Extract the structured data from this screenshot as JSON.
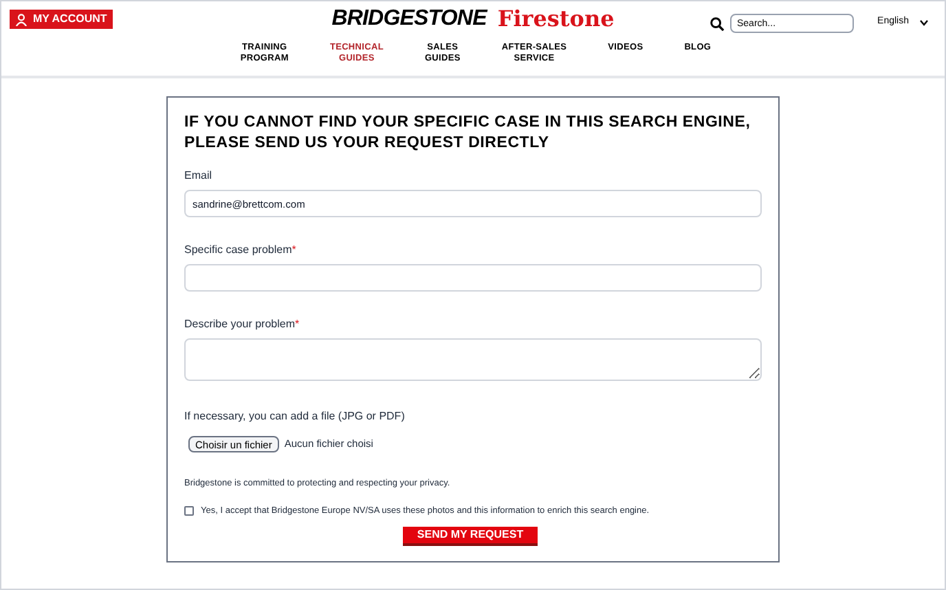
{
  "header": {
    "account_button": "MY ACCOUNT",
    "logos": [
      "BRIDGESTONE",
      "Firestone"
    ],
    "search": {
      "placeholder": "Search..."
    },
    "language": "English",
    "nav": [
      {
        "label": "TRAINING\nPROGRAM",
        "selected": false
      },
      {
        "label": "TECHNICAL\nGUIDES",
        "selected": true
      },
      {
        "label": "SALES\nGUIDES",
        "selected": false
      },
      {
        "label": "AFTER-SALES\nSERVICE",
        "selected": false
      },
      {
        "label": "VIDEOS",
        "selected": false
      },
      {
        "label": "BLOG",
        "selected": false
      }
    ]
  },
  "form": {
    "title": "IF YOU CANNOT FIND YOUR SPECIFIC CASE IN THIS SEARCH ENGINE, PLEASE SEND US YOUR REQUEST DIRECTLY",
    "fields": [
      {
        "kind": "input",
        "label": "Email",
        "value": "sandrine@brettcom.com"
      },
      {
        "kind": "input",
        "label": "Specific case problem",
        "required_mark": "*"
      },
      {
        "kind": "textarea",
        "label": "Describe your problem",
        "required_mark": "*"
      }
    ],
    "file": {
      "label": "If necessary, you can add a file (JPG or PDF)",
      "button": "Choisir un fichier",
      "status": "Aucun fichier choisi"
    },
    "privacy": "Bridgestone is committed to protecting and respecting your privacy.",
    "consent": {
      "label": "Yes, I accept that Bridgestone Europe NV/SA uses these photos and this information to enrich this search engine.",
      "checked": false
    },
    "submit": "SEND MY REQUEST"
  }
}
